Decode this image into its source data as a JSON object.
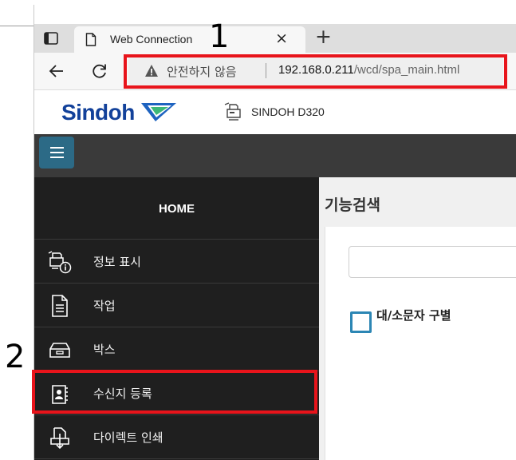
{
  "annotations": {
    "first": "1",
    "second": "2"
  },
  "browser": {
    "tab_title": "Web Connection",
    "tab_close": "×",
    "new_tab": "+",
    "address": {
      "security_warning": "안전하지 않음",
      "host": "192.168.0.211",
      "path": "/wcd/spa_main.html"
    }
  },
  "header": {
    "brand": "Sindoh",
    "device_name": "SINDOH D320",
    "brand_colors": {
      "text": "#12419a",
      "mark_blue": "#1e63c0",
      "mark_green": "#3cb878"
    }
  },
  "sidebar": {
    "home": "HOME",
    "items": [
      {
        "label": "정보 표시",
        "icon": "info-printer-icon"
      },
      {
        "label": "작업",
        "icon": "document-icon"
      },
      {
        "label": "박스",
        "icon": "box-icon"
      },
      {
        "label": "수신지 등록",
        "icon": "address-book-icon"
      },
      {
        "label": "다이렉트 인쇄",
        "icon": "direct-print-icon"
      }
    ]
  },
  "main": {
    "title": "기능검색",
    "search_placeholder": "",
    "checkbox_label": "대/소문자 구별"
  },
  "colors": {
    "highlight": "#e8141b",
    "accent": "#2c6a86",
    "checkbox": "#2c86b4"
  }
}
